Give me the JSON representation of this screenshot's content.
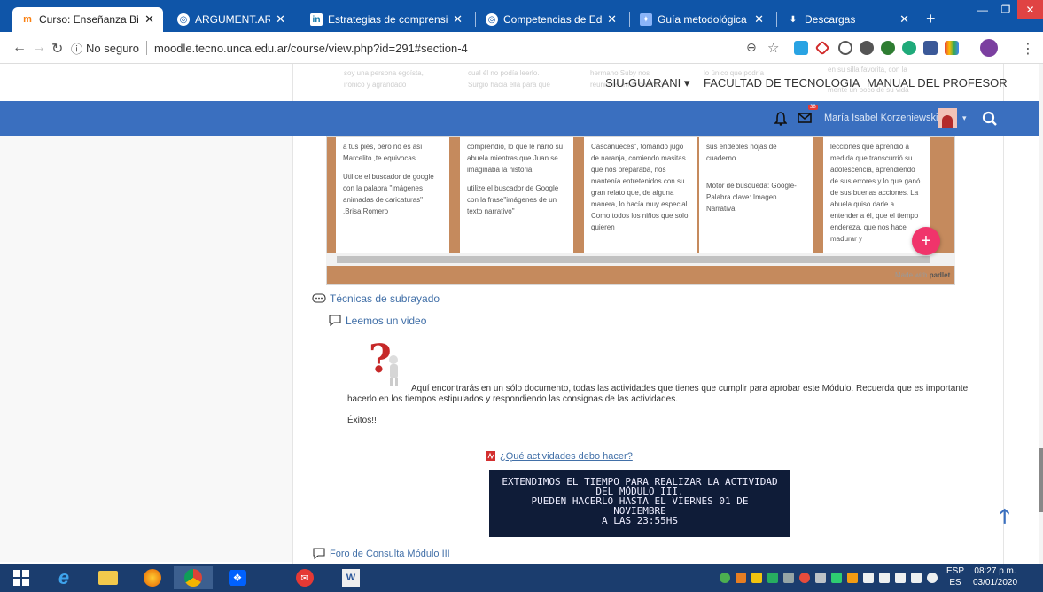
{
  "browser": {
    "tabs": [
      {
        "title": "Curso: Enseñanza Bimoda",
        "active": true,
        "favicon": "moodle-icon"
      },
      {
        "title": "ARGUMENT.AR",
        "active": false,
        "favicon": "globe-icon"
      },
      {
        "title": "Estrategias de comprensi",
        "active": false,
        "favicon": "linkedin-icon"
      },
      {
        "title": "Competencias de Educac",
        "active": false,
        "favicon": "globe-icon"
      },
      {
        "title": "Guía metodológica para",
        "active": false,
        "favicon": "puzzle-icon"
      },
      {
        "title": "Descargas",
        "active": false,
        "favicon": "download-icon"
      }
    ],
    "security": "No seguro",
    "url": "moodle.tecno.unca.edu.ar/course/view.php?id=291#section-4"
  },
  "moodle": {
    "topnav": {
      "siu": "SIU-GUARANI",
      "facultad": "FACULTAD DE TECNOLOGIA",
      "manual": "MANUAL DEL PROFESOR"
    },
    "user_name": "María Isabel Korzeniewski",
    "notification_badge": "38"
  },
  "padlet": {
    "col1_ghost": [
      "soy una persona egoísta,",
      "irónico y agrandado"
    ],
    "col1": [
      "a tus pies, pero no es así Marcelito ,te equivocas.",
      "Utilice el buscador de google con la palabra \"imágenes animadas de caricaturas\" .Brisa Romero"
    ],
    "col2_ghost": [
      "cual él no podía leerlo.",
      "Surgió hacia ella para que"
    ],
    "col2": [
      "comprendió, lo que le narro su abuela mientras que Juan se imaginaba la historia.",
      "utilize el buscador de Google con la frase\"imágenes de un texto narrativo\""
    ],
    "col3_ghost": [
      "hermano Suby nos",
      "reunimos en la cocina y"
    ],
    "col3": [
      "Cascanueces\", tomando jugo de naranja, comiendo masitas que nos preparaba, nos mantenía entretenidos con su gran relato que, de alguna manera, lo hacía muy especial. Como todos los niños que solo quieren"
    ],
    "col4_ghost": [
      "lo único que podría"
    ],
    "col4": [
      "sus endebles hojas de cuaderno.",
      "Motor de búsqueda: Google- Palabra clave: Imagen Narrativa."
    ],
    "col5_ghost": [
      "en su silla favorita, con la",
      "mente un poco de su vida"
    ],
    "col5": [
      "lecciones que aprendió a medida que transcurrió su adolescencia, aprendiendo de sus errores y lo que ganó de sus buenas acciones. La abuela quiso darle a entender a él, que el tiempo endereza, que nos hace madurar y"
    ],
    "made_with": "Made with",
    "brand": "padlet"
  },
  "activities": {
    "tecnicas": "Técnicas de subrayado",
    "leemos": "Leemos un video",
    "description_line1": "Aquí encontrarás en un sólo documento, todas las actividades que tienes que cumplir para aprobar este Módulo. Recuerda que es importante",
    "description_line2": "hacerlo en los tiempos estipulados  y respondiendo las consignas de las actividades.",
    "exitos": "Éxitos!!",
    "pdf_link": "¿Qué actividades debo hacer?",
    "banner_lines": [
      "EXTENDIMOS EL TIEMPO PARA REALIZAR LA ACTIVIDAD",
      "DEL MÓDULO III.",
      "PUEDEN HACERLO HASTA EL VIERNES 01 DE",
      "NOVIEMBRE",
      "A LAS 23:55HS"
    ],
    "foro": "Foro de Consulta Módulo III"
  },
  "taskbar": {
    "lang": "ESP",
    "lang2": "ES",
    "time": "08:27 p.m.",
    "date": "03/01/2020"
  },
  "colors": {
    "accent": "#3a6fbf",
    "chrome": "#0f55a8",
    "fab": "#f0346b",
    "padlet_bg": "#c58a5d"
  }
}
